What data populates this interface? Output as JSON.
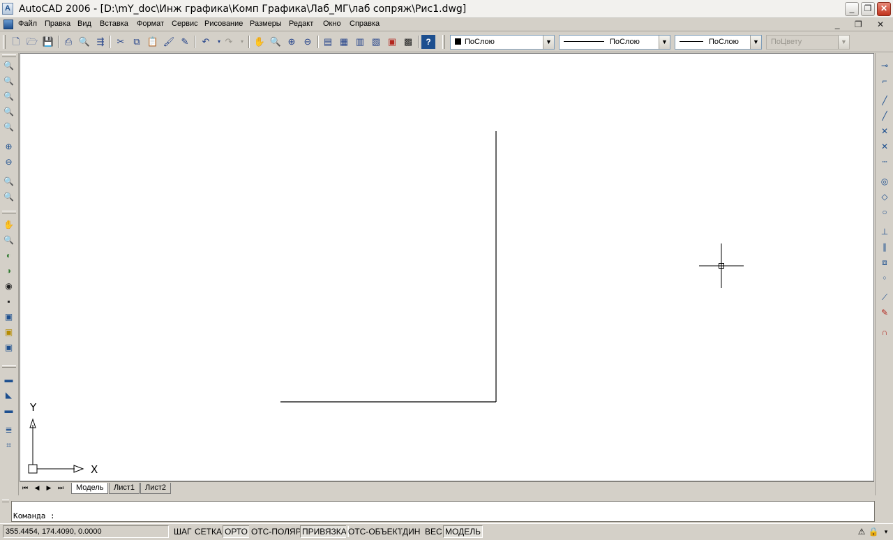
{
  "window": {
    "title": "AutoCAD 2006 - [D:\\mY_doc\\Инж графика\\Комп Графика\\Лаб_МГ\\лаб сопряж\\Рис1.dwg]",
    "minimize": "_",
    "restore": "❐",
    "close": "✕"
  },
  "menu": {
    "items": [
      "Файл",
      "Правка",
      "Вид",
      "Вставка",
      "Формат",
      "Сервис",
      "Рисование",
      "Размеры",
      "Редакт",
      "Окно",
      "Справка"
    ],
    "mdi_controls": "_ ❐ ✕"
  },
  "toolbar": {
    "icons": [
      "new-icon",
      "open-icon",
      "save-icon",
      "print-icon",
      "preview-icon",
      "publish-icon",
      "cut-icon",
      "copy-icon",
      "paste-icon",
      "match-properties-icon",
      "block-editor-icon",
      "undo-icon",
      "redo-icon",
      "pan-icon",
      "zoom-realtime-icon",
      "zoom-window-icon",
      "zoom-previous-icon",
      "properties-icon",
      "design-center-icon",
      "tool-palettes-icon",
      "sheet-set-icon",
      "markup-icon",
      "calculator-icon",
      "help-icon"
    ],
    "layer_combo": "ПоСлою",
    "linetype_combo": "ПоСлою",
    "lineweight_combo": "ПоСлою",
    "plotstyle_combo": "ПоЦвету"
  },
  "layout_tabs": [
    "Модель",
    "Лист1",
    "Лист2"
  ],
  "ucs": {
    "y_label": "Y",
    "x_label": "X"
  },
  "command": {
    "prompt": "Команда :"
  },
  "status": {
    "coords": "355.4454, 174.4090, 0.0000",
    "buttons": [
      "ШАГ",
      "СЕТКА",
      "ОРТО",
      "ОТС-ПОЛЯР",
      "ПРИВЯЗКА",
      "ОТС-ОБЪЕКТ",
      "ДИН",
      "ВЕС",
      "МОДЕЛЬ"
    ],
    "pressed": [
      "ОРТО",
      "ПРИВЯЗКА",
      "МОДЕЛЬ"
    ]
  },
  "colors": {
    "chrome": "#d4d0c8",
    "canvas": "#ffffff",
    "accent_icon": "#1d4f8f",
    "close_button": "#c1321d"
  }
}
